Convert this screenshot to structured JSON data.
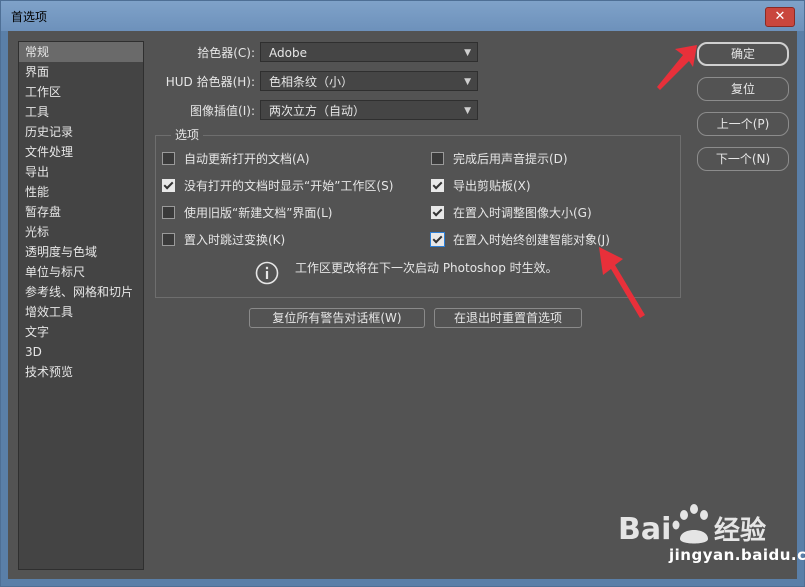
{
  "window": {
    "title": "首选项",
    "close_label": "✕"
  },
  "sidebar": {
    "items": [
      {
        "label": "常规",
        "active": true
      },
      {
        "label": "界面"
      },
      {
        "label": "工作区"
      },
      {
        "label": "工具"
      },
      {
        "label": "历史记录"
      },
      {
        "label": "文件处理"
      },
      {
        "label": "导出"
      },
      {
        "label": "性能"
      },
      {
        "label": "暂存盘"
      },
      {
        "label": "光标"
      },
      {
        "label": "透明度与色域"
      },
      {
        "label": "单位与标尺"
      },
      {
        "label": "参考线、网格和切片"
      },
      {
        "label": "增效工具"
      },
      {
        "label": "文字"
      },
      {
        "label": "3D"
      },
      {
        "label": "技术预览"
      }
    ]
  },
  "settings": {
    "color_picker": {
      "label": "拾色器(C):",
      "value": "Adobe"
    },
    "hud_picker": {
      "label": "HUD 拾色器(H):",
      "value": "色相条纹（小）"
    },
    "interpolation": {
      "label": "图像插值(I):",
      "value": "两次立方（自动）"
    }
  },
  "options": {
    "title": "选项",
    "left": [
      {
        "label": "自动更新打开的文档(A)",
        "checked": false
      },
      {
        "label": "没有打开的文档时显示“开始”工作区(S)",
        "checked": true
      },
      {
        "label": "使用旧版“新建文档”界面(L)",
        "checked": false
      },
      {
        "label": "置入时跳过变换(K)",
        "checked": false
      }
    ],
    "right": [
      {
        "label": "完成后用声音提示(D)",
        "checked": false
      },
      {
        "label": "导出剪贴板(X)",
        "checked": true
      },
      {
        "label": "在置入时调整图像大小(G)",
        "checked": true
      },
      {
        "label": "在置入时始终创建智能对象(J)",
        "checked": true
      }
    ],
    "info": "工作区更改将在下一次启动 Photoshop 时生效。"
  },
  "bottom_buttons": {
    "reset_warnings": "复位所有警告对话框(W)",
    "reset_on_quit": "在退出时重置首选项"
  },
  "right_buttons": {
    "ok": "确定",
    "reset": "复位",
    "prev": "上一个(P)",
    "next": "下一个(N)"
  },
  "watermark": {
    "text": "jingyan.baidu.com"
  },
  "colors": {
    "arrow": "#e8303a",
    "accent": "#2d7fd6"
  }
}
